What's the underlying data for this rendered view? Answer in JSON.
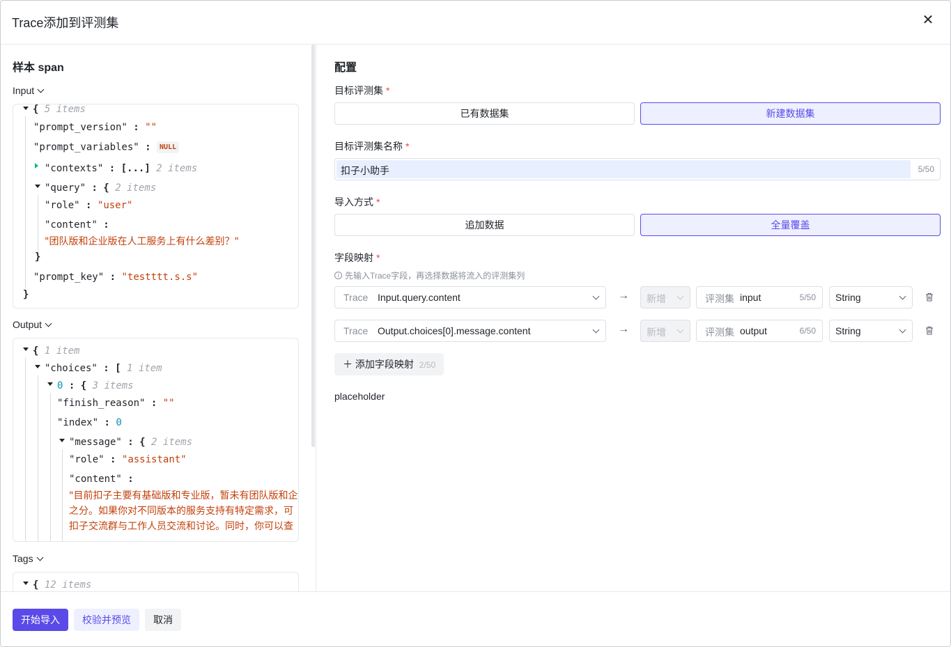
{
  "dialog": {
    "title": "Trace添加到评测集",
    "close_icon": "close-icon"
  },
  "left": {
    "section_title": "样本 span",
    "input_label": "Input",
    "output_label": "Output",
    "tags_label": "Tags",
    "input_json": {
      "root_meta": "5 items",
      "k_prompt_version": "\"prompt_version\"",
      "v_prompt_version": "\"\"",
      "k_prompt_variables": "\"prompt_variables\"",
      "v_prompt_variables": "NULL",
      "k_contexts": "\"contexts\"",
      "v_contexts": "[...]",
      "contexts_meta": "2 items",
      "k_query": "\"query\"",
      "query_meta": "2 items",
      "k_role": "\"role\"",
      "v_role": "\"user\"",
      "k_content": "\"content\"",
      "v_content": "\"团队版和企业版在人工服务上有什么差别？\"",
      "k_prompt_key": "\"prompt_key\"",
      "v_prompt_key": "\"testttt.s.s\""
    },
    "output_json": {
      "root_meta": "1 item",
      "k_choices": "\"choices\"",
      "choices_meta": "1 item",
      "k_index0": "0",
      "index0_meta": "3 items",
      "k_finish_reason": "\"finish_reason\"",
      "v_finish_reason": "\"\"",
      "k_index": "\"index\"",
      "v_index": "0",
      "k_message": "\"message\"",
      "message_meta": "2 items",
      "k_role": "\"role\"",
      "v_role": "\"assistant\"",
      "k_content": "\"content\"",
      "v_content_line1": "\"目前扣子主要有基础版和专业版，暂未有团队版和企",
      "v_content_line2": "之分。如果你对不同版本的服务支持有特定需求，可",
      "v_content_line3": "扣子交流群与工作人员交流和讨论。同时，你可以查"
    },
    "tags_json": {
      "root_meta": "12 items"
    }
  },
  "right": {
    "section_title": "配置",
    "target_label": "目标评测集",
    "target_options": [
      "已有数据集",
      "新建数据集"
    ],
    "target_selected": "新建数据集",
    "name_label": "目标评测集名称",
    "name_value": "扣子小助手",
    "name_count": "5/50",
    "import_label": "导入方式",
    "import_options": [
      "追加数据",
      "全量覆盖"
    ],
    "import_selected": "全量覆盖",
    "mapping_label": "字段映射",
    "mapping_hint": "先输入Trace字段，再选择数据将流入的评测集列",
    "mappings": [
      {
        "trace_prefix": "Trace",
        "trace_field": "Input.query.content",
        "action": "新增",
        "set_prefix": "评测集",
        "set_field": "input",
        "set_count": "5/50",
        "type": "String"
      },
      {
        "trace_prefix": "Trace",
        "trace_field": "Output.choices[0].message.content",
        "action": "新增",
        "set_prefix": "评测集",
        "set_field": "output",
        "set_count": "6/50",
        "type": "String"
      }
    ],
    "add_mapping_label": "添加字段映射",
    "add_mapping_count": "2/50",
    "placeholder_text": "placeholder"
  },
  "footer": {
    "start_import": "开始导入",
    "validate_preview": "校验并预览",
    "cancel": "取消"
  },
  "colors": {
    "accent": "#5a4ae8",
    "string": "#c2410c",
    "number": "#0891b2",
    "required": "#f53f3f"
  }
}
